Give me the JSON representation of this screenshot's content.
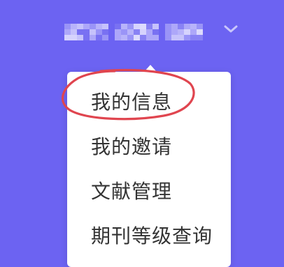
{
  "header": {
    "username_masked": true,
    "dropdown_icon": "chevron-down-icon"
  },
  "menu": {
    "items": [
      {
        "label": "我的信息"
      },
      {
        "label": "我的邀请"
      },
      {
        "label": "文献管理"
      },
      {
        "label": "期刊等级查询"
      }
    ]
  },
  "annotation": {
    "color": "#e0454f",
    "target_index": 0
  },
  "colors": {
    "background": "#6c63f2",
    "menu_bg": "#ffffff",
    "menu_text": "#333333"
  }
}
